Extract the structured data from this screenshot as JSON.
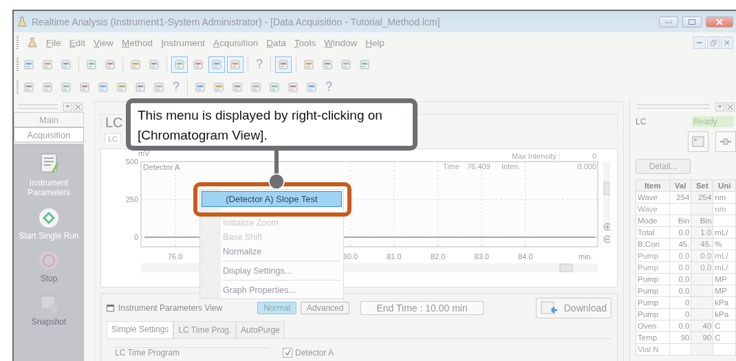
{
  "window": {
    "title": "Realtime Analysis (Instrument1-System Administrator) - [Data Acquisition - Tutorial_Method.lcm]"
  },
  "menu": [
    "File",
    "Edit",
    "View",
    "Method",
    "Instrument",
    "Acquisition",
    "Data",
    "Tools",
    "Window",
    "Help"
  ],
  "toolbars": [
    [
      {
        "kind": "button",
        "pressed": false
      },
      {
        "kind": "button",
        "pressed": false
      },
      {
        "kind": "button",
        "pressed": false
      },
      {
        "kind": "separator"
      },
      {
        "kind": "button",
        "pressed": false
      },
      {
        "kind": "button",
        "pressed": false
      },
      {
        "kind": "separator"
      },
      {
        "kind": "button",
        "pressed": false
      },
      {
        "kind": "button",
        "pressed": false
      },
      {
        "kind": "separator"
      },
      {
        "kind": "button",
        "pressed": true
      },
      {
        "kind": "button",
        "pressed": false
      },
      {
        "kind": "button",
        "pressed": true
      },
      {
        "kind": "button",
        "pressed": true
      },
      {
        "kind": "separator"
      },
      {
        "kind": "help",
        "label": "?"
      },
      {
        "kind": "separator"
      },
      {
        "kind": "button",
        "pressed": true
      },
      {
        "kind": "separator"
      },
      {
        "kind": "button",
        "pressed": false
      },
      {
        "kind": "button",
        "pressed": false
      },
      {
        "kind": "button",
        "pressed": false
      },
      {
        "kind": "button",
        "pressed": false
      }
    ],
    [
      {
        "kind": "button",
        "pressed": false
      },
      {
        "kind": "button",
        "pressed": false
      },
      {
        "kind": "button",
        "pressed": false
      },
      {
        "kind": "button",
        "pressed": false
      },
      {
        "kind": "button",
        "pressed": false
      },
      {
        "kind": "button",
        "pressed": false
      },
      {
        "kind": "button",
        "pressed": false
      },
      {
        "kind": "button",
        "pressed": false
      },
      {
        "kind": "help",
        "label": "?"
      },
      {
        "kind": "separator"
      },
      {
        "kind": "button",
        "pressed": false
      },
      {
        "kind": "button",
        "pressed": false
      },
      {
        "kind": "button",
        "pressed": false
      },
      {
        "kind": "button",
        "pressed": false
      },
      {
        "kind": "button",
        "pressed": false
      },
      {
        "kind": "button",
        "pressed": false
      },
      {
        "kind": "button",
        "pressed": false
      },
      {
        "kind": "help",
        "label": "?"
      }
    ]
  ],
  "nav_tabs": [
    {
      "label": "Main",
      "selected": false
    },
    {
      "label": "Acquisition",
      "selected": true
    }
  ],
  "sidebar": {
    "items": [
      {
        "kind": "params",
        "label": "Instrument Parameters",
        "disabled": false
      },
      {
        "kind": "start",
        "label": "Start Single Run",
        "disabled": false
      },
      {
        "kind": "stop",
        "label": "Stop",
        "disabled": true
      },
      {
        "kind": "snapshot",
        "label": "Snapshot",
        "disabled": true
      }
    ]
  },
  "view": {
    "title": "LC",
    "tab": "LC",
    "chart": {
      "max_intensity_label": "Max Intensity :",
      "max_intensity": "0",
      "time_label": "Time",
      "time": "76.409",
      "inten_label": "Inten.",
      "inten": "0.000",
      "chart_data": {
        "type": "line",
        "grid": true,
        "xlabel": "min",
        "ylabel": "mV",
        "x": [
          75.3,
          85.6
        ],
        "series": [
          {
            "name": "Detector A",
            "color": "#8c8c8c",
            "values": [
              0,
              0
            ]
          }
        ],
        "xlim": [
          75.22,
          85.65
        ],
        "ylim": [
          -64,
          500
        ],
        "xticks": [
          {
            "value": 76,
            "label": "76.0"
          },
          {
            "value": 80,
            "label": "80.0"
          },
          {
            "value": 81,
            "label": "81.0"
          },
          {
            "value": 82,
            "label": "82.0"
          },
          {
            "value": 83,
            "label": "83.0"
          },
          {
            "value": 84,
            "label": "84.0"
          }
        ],
        "yticks": [
          {
            "value": 0,
            "label": "0"
          },
          {
            "value": 250,
            "label": "250"
          },
          {
            "value": 500,
            "label": "500"
          }
        ]
      }
    }
  },
  "params_view": {
    "title": "Instrument Parameters View",
    "modes": [
      {
        "label": "Normal",
        "selected": true
      },
      {
        "label": "Advanced",
        "selected": false
      }
    ],
    "end_time": "End Time : 10.00 min",
    "download": "Download",
    "tabs": [
      {
        "label": "Simple Settings",
        "selected": true
      },
      {
        "label": "LC Time Prog.",
        "selected": false
      },
      {
        "label": "AutoPurge",
        "selected": false
      }
    ],
    "group": "LC Time Program",
    "detector": {
      "label": "Detector A",
      "checked": true
    }
  },
  "status_panel": {
    "name": "LC",
    "status": "Ready",
    "detail_button": "Detail...",
    "table": {
      "columns": [
        "Item",
        "Val",
        "Set",
        "Uni"
      ],
      "rows": [
        {
          "item": "Wave",
          "val": "254",
          "set": "254",
          "unit": "nm",
          "disabled": false
        },
        {
          "item": "Wave",
          "unit": "nm",
          "disabled": true
        },
        {
          "item": "Mode",
          "val": "Bin",
          "set": "Bin",
          "disabled": false
        },
        {
          "item": "Total",
          "val": "0.0",
          "set": "1.0",
          "unit": "mL/",
          "disabled": false
        },
        {
          "item": "B.Con",
          "val": "45.",
          "set": "45.",
          "unit": "%",
          "disabled": false
        },
        {
          "item": "Pump",
          "val": "0.0",
          "set": "0.0",
          "unit": "mL/",
          "disabled": true
        },
        {
          "item": "Pump",
          "val": "0.0",
          "set": "0.0",
          "unit": "mL/",
          "disabled": true
        },
        {
          "item": "Pump",
          "val": "0.0",
          "unit": "MP",
          "disabled": false
        },
        {
          "item": "Pump",
          "val": "0.0",
          "unit": "MP",
          "disabled": false
        },
        {
          "item": "Pump",
          "val": "0",
          "unit": "kPa",
          "disabled": false
        },
        {
          "item": "Pump",
          "val": "0",
          "unit": "kPa",
          "disabled": false
        },
        {
          "item": "Oven",
          "val": "0.0",
          "set": "40",
          "unit": "C",
          "disabled": false
        },
        {
          "item": "Temp",
          "val": "90",
          "set": "90",
          "unit": "C",
          "disabled": false
        },
        {
          "item": "Vial N",
          "disabled": true
        }
      ]
    }
  },
  "context_menu": {
    "items": [
      {
        "label": "(Detector A) Slope Test",
        "selected": true,
        "disabled": false,
        "separator_before": false
      },
      {
        "label": "Initialize Zoom",
        "selected": false,
        "disabled": true,
        "separator_before": false
      },
      {
        "label": "Base Shift",
        "selected": false,
        "disabled": true,
        "separator_before": false
      },
      {
        "label": "Normalize",
        "selected": false,
        "disabled": false,
        "separator_before": false
      },
      {
        "label": "Display Settings...",
        "selected": false,
        "disabled": false,
        "separator_before": true
      },
      {
        "label": "Graph Properties...",
        "selected": false,
        "disabled": false,
        "separator_before": true
      }
    ]
  },
  "callout": {
    "text": "This menu is displayed by right-clicking on [Chromatogram View]."
  }
}
